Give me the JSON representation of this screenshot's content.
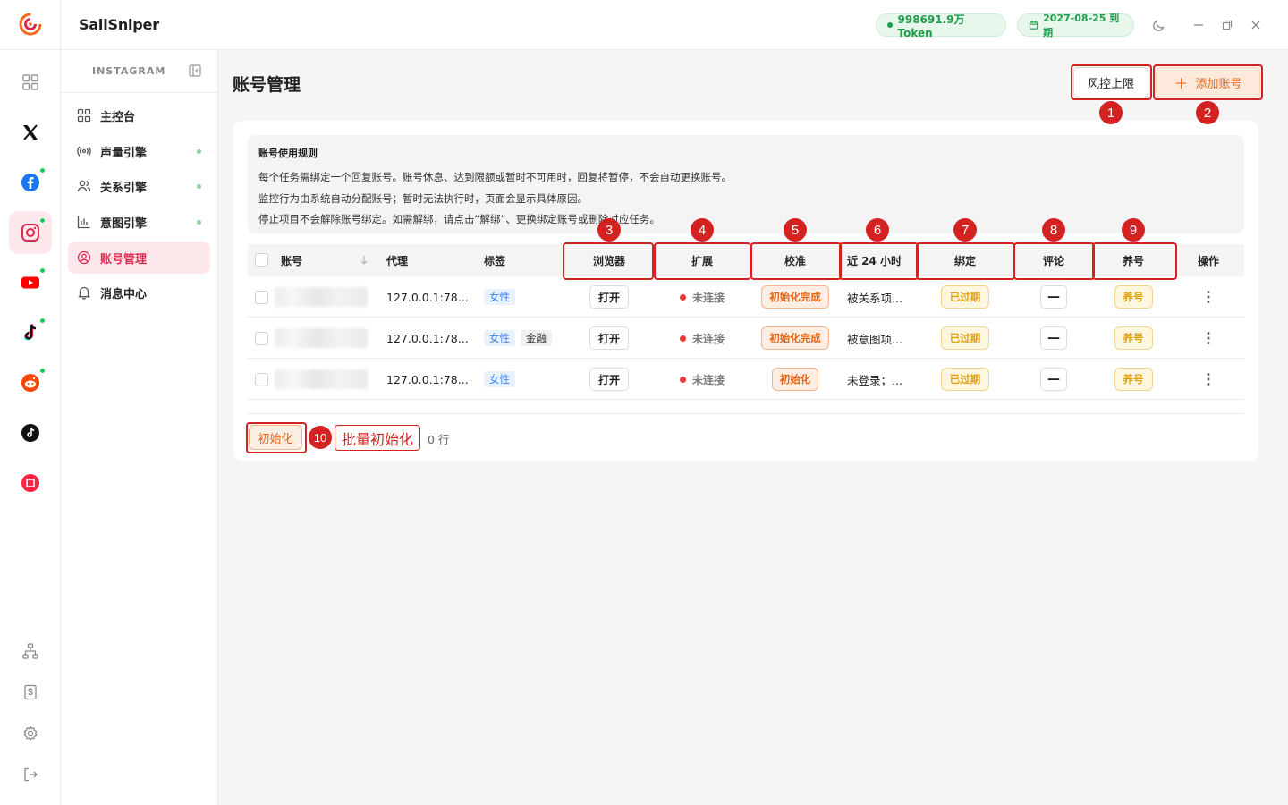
{
  "app": {
    "brand": "SailSniper"
  },
  "header": {
    "token_text": "998691.9万 Token",
    "expiry_text": "2027-08-25 到期"
  },
  "rail": {
    "items": [
      {
        "name": "dashboard-grid-icon"
      },
      {
        "name": "x-twitter-icon"
      },
      {
        "name": "facebook-icon",
        "online": true
      },
      {
        "name": "instagram-icon",
        "online": true,
        "active": true
      },
      {
        "name": "youtube-icon",
        "online": true
      },
      {
        "name": "tiktok-icon",
        "online": true
      },
      {
        "name": "reddit-icon",
        "online": true
      },
      {
        "name": "tiktok-alt-icon"
      },
      {
        "name": "xiaohongshu-icon"
      }
    ]
  },
  "sidebar": {
    "section_title": "INSTAGRAM",
    "items": [
      {
        "label": "主控台",
        "icon": "dashboard-icon"
      },
      {
        "label": "声量引擎",
        "icon": "broadcast-icon",
        "dot": true
      },
      {
        "label": "关系引擎",
        "icon": "users-icon",
        "dot": true
      },
      {
        "label": "意图引擎",
        "icon": "bar-chart-icon",
        "dot": true
      },
      {
        "label": "账号管理",
        "icon": "account-icon",
        "active": true
      },
      {
        "label": "消息中心",
        "icon": "bell-icon"
      }
    ]
  },
  "main": {
    "title": "账号管理",
    "risk_button": "风控上限",
    "add_button": "添加账号",
    "rules": {
      "title": "账号使用规则",
      "lines": [
        "每个任务需绑定一个回复账号。账号休息、达到限额或暂时不可用时，回复将暂停，不会自动更换账号。",
        "监控行为由系统自动分配账号；暂时无法执行时，页面会显示具体原因。",
        "停止项目不会解除账号绑定。如需解绑，请点击“解绑”、更换绑定账号或删除对应任务。"
      ]
    },
    "table": {
      "headers": {
        "account": "账号",
        "proxy": "代理",
        "tags": "标签",
        "browser": "浏览器",
        "extension": "扩展",
        "calibrate": "校准",
        "last24h": "近 24 小时",
        "binding": "绑定",
        "comment": "评论",
        "nurture": "养号",
        "actions": "操作"
      },
      "rows": [
        {
          "proxy": "127.0.0.1:78...",
          "tags": [
            "女性"
          ],
          "browser": "打开",
          "extension": "未连接",
          "calibrate": "初始化完成",
          "last24h": "被关系项...",
          "binding": "已过期",
          "comment": "—",
          "nurture": "养号"
        },
        {
          "proxy": "127.0.0.1:78...",
          "tags": [
            "女性",
            "金融"
          ],
          "browser": "打开",
          "extension": "未连接",
          "calibrate": "初始化完成",
          "last24h": "被意图项...",
          "binding": "已过期",
          "comment": "—",
          "nurture": "养号"
        },
        {
          "proxy": "127.0.0.1:78...",
          "tags": [
            "女性"
          ],
          "browser": "打开",
          "extension": "未连接",
          "calibrate": "初始化",
          "last24h": "未登录；...",
          "binding": "已过期",
          "comment": "—",
          "nurture": "养号"
        }
      ]
    },
    "footer": {
      "init_button": "初始化",
      "selected_text": "0 行"
    }
  },
  "annotations": {
    "numbers": [
      "1",
      "2",
      "3",
      "4",
      "5",
      "6",
      "7",
      "8",
      "9",
      "10"
    ],
    "batch_label": "批量初始化",
    "color": "#d32222"
  }
}
